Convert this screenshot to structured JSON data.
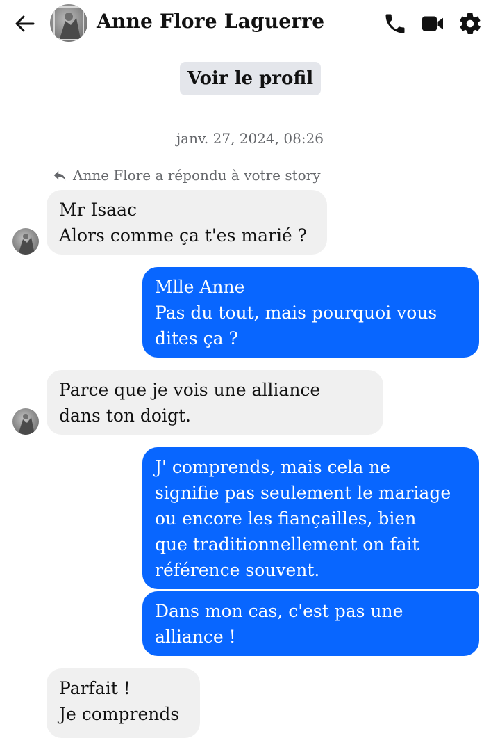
{
  "header": {
    "contact_name": "Anne Flore Laguerre",
    "icons": [
      "back-arrow-icon",
      "phone-icon",
      "video-camera-icon",
      "gear-icon"
    ]
  },
  "profile_button": "Voir le profil",
  "timestamp": "janv. 27, 2024, 08:26",
  "reply_note": "Anne Flore a répondu à votre story",
  "messages": [
    {
      "from": "them",
      "text": "Mr Isaac\nAlors comme ça t'es marié ?"
    },
    {
      "from": "me",
      "text": "Mlle Anne\nPas du tout, mais pourquoi vous\ndites ça ?"
    },
    {
      "from": "them",
      "text": "Parce que je vois une alliance\ndans ton doigt."
    },
    {
      "from": "me",
      "text": "J' comprends, mais cela ne\nsignifie pas seulement le mariage\nou encore les fiançailles, bien\nque traditionnellement on fait\nréférence souvent."
    },
    {
      "from": "me",
      "text": "Dans mon cas, c'est pas une\nalliance !"
    },
    {
      "from": "them",
      "text": "Parfait !\nJe comprends"
    }
  ],
  "colors": {
    "outgoing_bubble": "#0866ff",
    "incoming_bubble": "#f0f0f0",
    "meta_text": "#65676b"
  }
}
